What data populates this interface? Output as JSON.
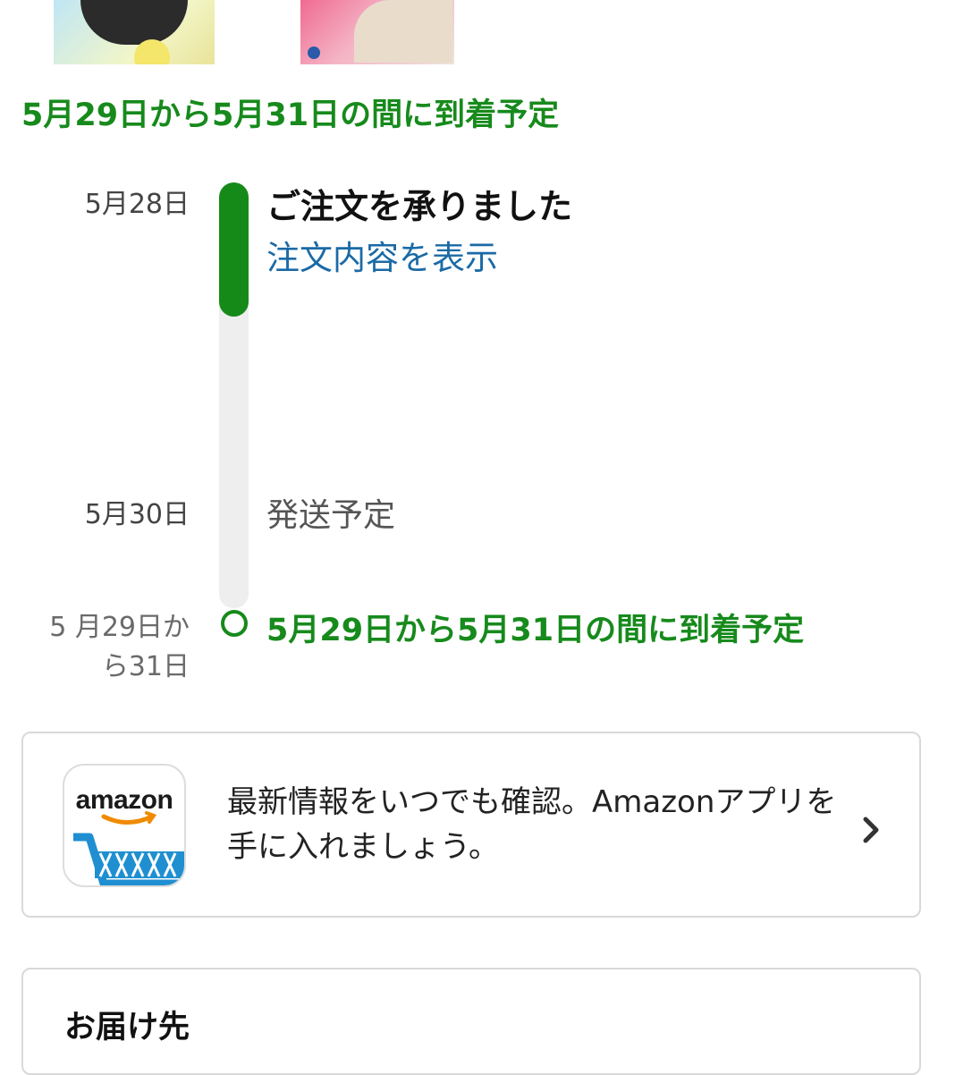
{
  "delivery_headline": "5月29日から5月31日の間に到着予定",
  "timeline": [
    {
      "date": "5月28日",
      "title": "ご注文を承りました",
      "link": "注文内容を表示"
    },
    {
      "date": "5月30日",
      "title": "発送予定"
    },
    {
      "date": "5 月29日か\nら31日",
      "title": "5月29日から5月31日の間に到着予定"
    }
  ],
  "progress_fraction": 0.3,
  "app_promo": {
    "icon_text": "amazon",
    "text": "最新情報をいつでも確認。Amazonアプリを手に入れましょう。"
  },
  "address_card": {
    "title": "お届け先"
  },
  "colors": {
    "accent_green": "#178a1c",
    "link_blue": "#1a6aa6",
    "amazon_orange": "#f08a00",
    "cart_blue": "#1f8fd1"
  },
  "icons": [
    "chevron-right-icon",
    "amazon-cart-icon"
  ]
}
